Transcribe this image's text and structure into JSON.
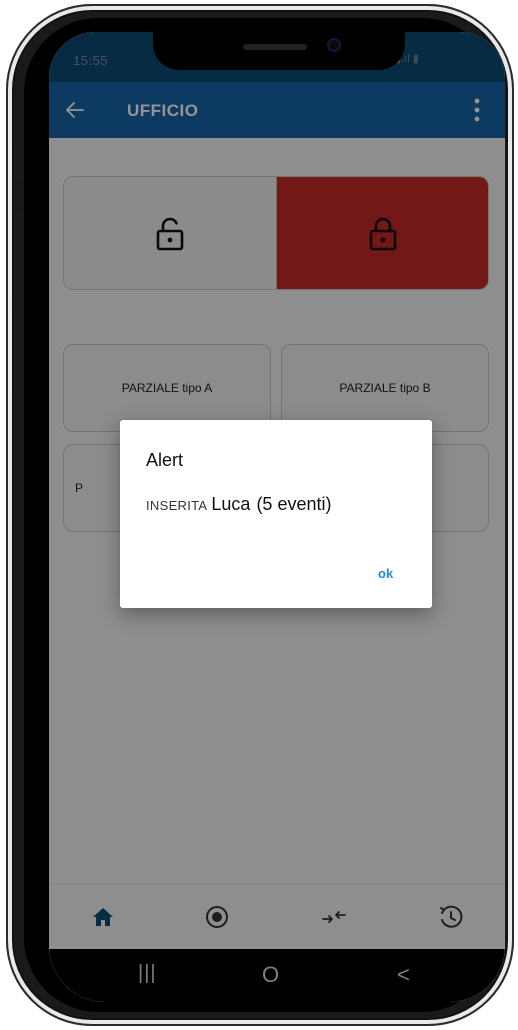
{
  "status_bar": {
    "time": "15:55",
    "indicators": "▮▮.ıl ▮"
  },
  "app_bar": {
    "title": "UFFICIO",
    "back_icon": "arrow-back-icon",
    "menu_icon": "more-vert-icon",
    "color": "#1565a8"
  },
  "lock_panel": {
    "left_icon": "unlock-icon",
    "right_icon": "lock-icon",
    "right_color": "#c62828"
  },
  "partials": {
    "a_label": "PARZIALE tipo A",
    "b_label": "PARZIALE tipo B",
    "c_label": "P",
    "d_label": ""
  },
  "dialog": {
    "title": "Alert",
    "type": "INSERITA",
    "name": "Luca",
    "count": "(5 eventi)",
    "ok_label": "ok",
    "ok_color": "#1e88e5"
  },
  "bottom_nav": {
    "items": [
      "home-icon",
      "radio-button-icon",
      "swap-arrows-icon",
      "history-icon"
    ],
    "active_color": "#0f4a76"
  },
  "system_nav": {
    "recent": "|||",
    "home": "O",
    "back": "<"
  }
}
